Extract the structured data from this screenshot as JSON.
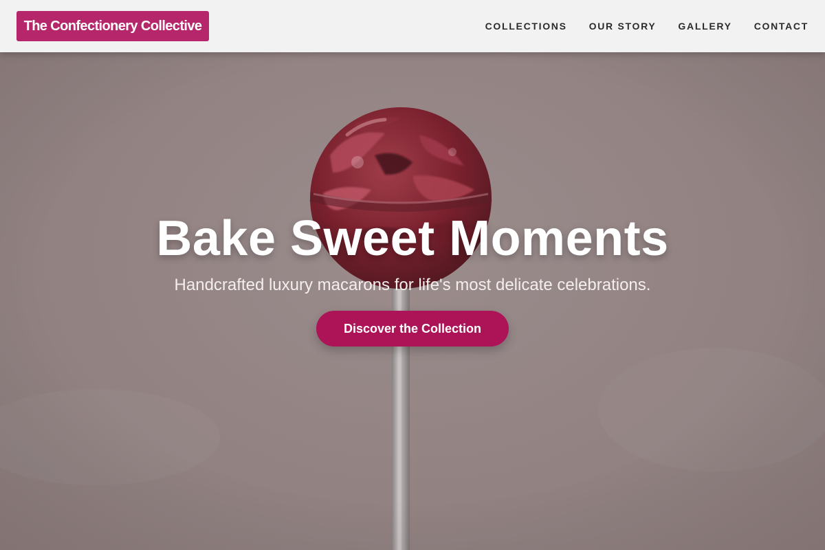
{
  "header": {
    "logo_text": "The Confectionery Collective",
    "nav": [
      {
        "label": "COLLECTIONS"
      },
      {
        "label": "OUR STORY"
      },
      {
        "label": "GALLERY"
      },
      {
        "label": "CONTACT"
      }
    ]
  },
  "hero": {
    "title": "Bake Sweet Moments",
    "subtitle": "Handcrafted luxury macarons for life's most delicate celebrations.",
    "cta_label": "Discover the Collection",
    "image_subject": "red-lollipop"
  },
  "colors": {
    "brand": "#b5266a",
    "cta": "#ad1457",
    "header_bg": "#f3f2f3",
    "nav_text": "#2b2b2b"
  }
}
